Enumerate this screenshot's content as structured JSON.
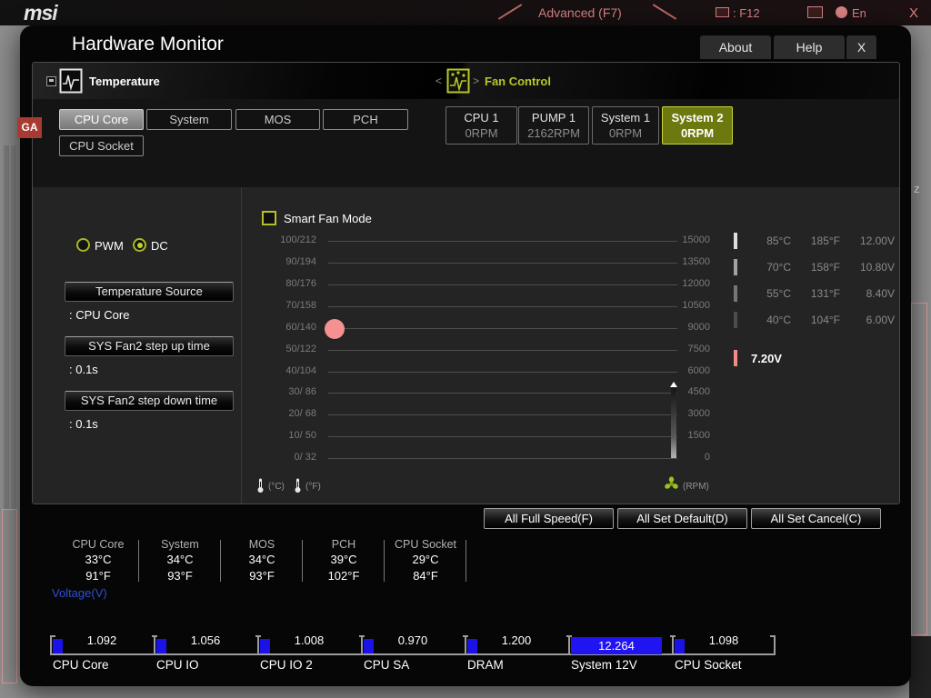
{
  "background": {
    "brand": "msi",
    "menu_advanced": "Advanced (F7)",
    "hotkey_f12": ": F12",
    "lang": "En",
    "close": "X",
    "badge": "GA",
    "text_fragment": "z"
  },
  "dialog": {
    "title": "Hardware Monitor",
    "about": "About",
    "help": "Help",
    "close": "X"
  },
  "header": {
    "temperature": "Temperature",
    "fan_control": "Fan Control",
    "prev": "<",
    "next": ">"
  },
  "temp_tabs": {
    "selected": "CPU Core",
    "items": [
      "CPU Core",
      "System",
      "MOS",
      "PCH",
      "CPU Socket"
    ]
  },
  "fans": {
    "selected": "System 2",
    "items": [
      {
        "name": "CPU 1",
        "rpm": "0RPM"
      },
      {
        "name": "PUMP 1",
        "rpm": "2162RPM"
      },
      {
        "name": "System 1",
        "rpm": "0RPM"
      },
      {
        "name": "System 2",
        "rpm": "0RPM"
      }
    ]
  },
  "mode": {
    "pwm": "PWM",
    "dc": "DC",
    "selected": "DC"
  },
  "fields": [
    {
      "label": "Temperature Source",
      "value": ": CPU Core"
    },
    {
      "label": "SYS Fan2 step up time",
      "value": ": 0.1s"
    },
    {
      "label": "SYS Fan2 step down time",
      "value": ": 0.1s"
    }
  ],
  "smart_fan": {
    "label": "Smart Fan Mode",
    "checked": false
  },
  "graph": {
    "temp_axis": [
      "100/212",
      "90/194",
      "80/176",
      "70/158",
      "60/140",
      "50/122",
      "40/104",
      "30/ 86",
      "20/ 68",
      "10/ 50",
      "0/ 32"
    ],
    "rpm_axis": [
      "15000",
      "13500",
      "12000",
      "10500",
      "9000",
      "7500",
      "6000",
      "4500",
      "3000",
      "1500",
      "0"
    ],
    "unit_c": "(°C)",
    "unit_f": "(°F)",
    "unit_rpm": "(RPM)",
    "point": {
      "temp_c": 60,
      "temp_f": 140,
      "rpm": 9000
    }
  },
  "gauge": {
    "rows": [
      {
        "c": "85°C",
        "f": "185°F",
        "v": "12.00V"
      },
      {
        "c": "70°C",
        "f": "158°F",
        "v": "10.80V"
      },
      {
        "c": "55°C",
        "f": "131°F",
        "v": "8.40V"
      },
      {
        "c": "40°C",
        "f": "104°F",
        "v": "6.00V"
      }
    ],
    "current_v": "7.20V"
  },
  "actions": [
    "All Full Speed(F)",
    "All Set Default(D)",
    "All Set Cancel(C)"
  ],
  "readouts": [
    {
      "name": "CPU Core",
      "c": "33°C",
      "f": "91°F"
    },
    {
      "name": "System",
      "c": "34°C",
      "f": "93°F"
    },
    {
      "name": "MOS",
      "c": "34°C",
      "f": "93°F"
    },
    {
      "name": "PCH",
      "c": "39°C",
      "f": "102°F"
    },
    {
      "name": "CPU Socket",
      "c": "29°C",
      "f": "84°F"
    }
  ],
  "voltage": {
    "title": "Voltage(V)",
    "items": [
      {
        "name": "CPU Core",
        "value": "1.092"
      },
      {
        "name": "CPU IO",
        "value": "1.056"
      },
      {
        "name": "CPU IO 2",
        "value": "1.008"
      },
      {
        "name": "CPU SA",
        "value": "0.970"
      },
      {
        "name": "DRAM",
        "value": "1.200"
      },
      {
        "name": "System 12V",
        "value": "12.264"
      },
      {
        "name": "CPU Socket",
        "value": "1.098"
      }
    ]
  },
  "colors": {
    "accent_olive": "#b9c62b",
    "dot_pink": "#f59191",
    "volt_blue": "#1a12e6",
    "volt_label_blue": "#2e4ed6"
  }
}
